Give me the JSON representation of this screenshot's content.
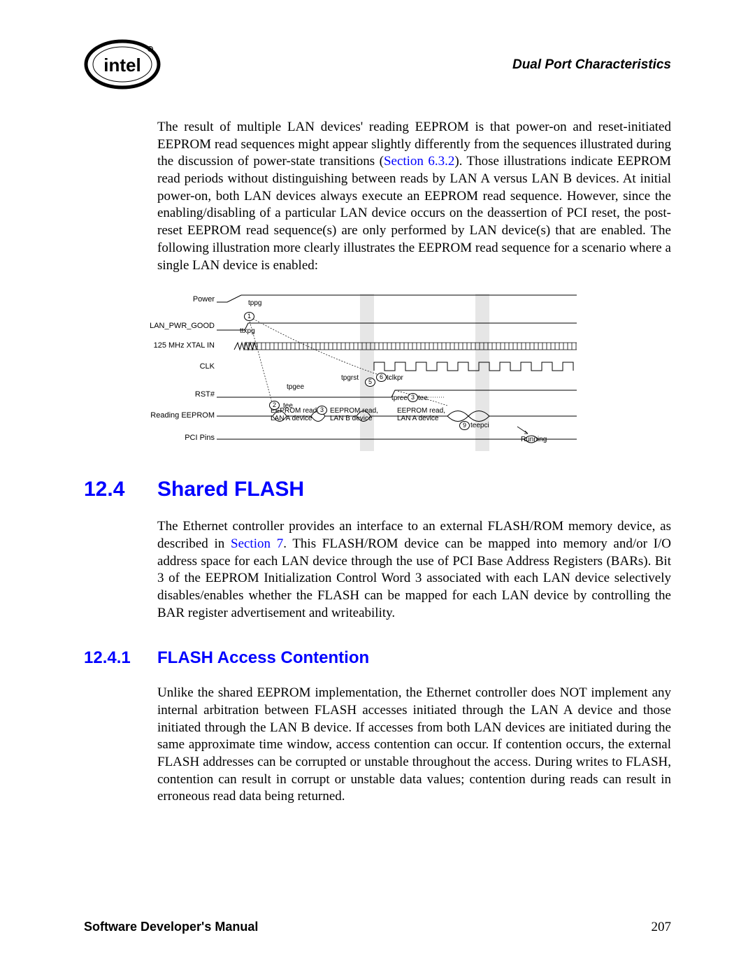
{
  "header": {
    "logo_label": "intel",
    "right": "Dual Port Characteristics"
  },
  "para1_a": "The result of multiple LAN devices' reading EEPROM is that power-on and reset-initiated EEPROM read sequences might appear slightly differently from the sequences illustrated during the discussion of power-state transitions (",
  "para1_link": "Section 6.3.2",
  "para1_b": "). Those illustrations indicate EEPROM read periods without distinguishing between reads by LAN A versus LAN B devices. At initial power-on, both LAN devices always execute an EEPROM read sequence. However, since the enabling/disabling of a particular LAN device occurs on the deassertion of PCI reset, the post-reset EEPROM read sequence(s) are only performed by LAN device(s) that are enabled. The following illustration more clearly illustrates the EEPROM read sequence for a scenario where a single LAN device is enabled:",
  "diagram": {
    "signals": {
      "power": "Power",
      "lan_pwr_good": "LAN_PWR_GOOD",
      "xtal": "125 MHz XTAL IN",
      "clk": "CLK",
      "rst": "RST#",
      "reading": "Reading EEPROM",
      "pci": "PCI Pins"
    },
    "annotations": {
      "tppg": "tppg",
      "ttxpg": "ttxpg",
      "tpgrst": "tpgrst",
      "tclkpr": "tclkpr",
      "tpgee": "tpgee",
      "tee1": "tee",
      "tee2": "tee",
      "tpree": "tpree",
      "teepci": "teepci",
      "running": "Running",
      "eeprom_a": "EEPROM read,",
      "lan_a": "LAN A device",
      "eeprom_b": "EEPROM read,",
      "lan_b": "LAN B device",
      "eeprom_a2": "EEPROM read,",
      "lan_a2": "LAN A device"
    },
    "markers": {
      "m1": "1",
      "m2": "2",
      "m3": "3",
      "m3b": "3",
      "m5": "5",
      "m6": "6",
      "m9": "9"
    }
  },
  "sec12_4": {
    "num": "12.4",
    "title": "Shared FLASH"
  },
  "para2_a": "The Ethernet controller provides an interface to an external FLASH/ROM memory device, as described in ",
  "para2_link": "Section 7",
  "para2_b": ". This FLASH/ROM device can be mapped into memory and/or I/O address space for each LAN device through the use of PCI Base Address Registers (BARs). Bit 3 of the EEPROM Initialization Control Word 3 associated with each LAN device selectively disables/enables whether the FLASH can be mapped for each LAN device by controlling the BAR register advertisement and writeability.",
  "sec12_4_1": {
    "num": "12.4.1",
    "title": "FLASH Access Contention"
  },
  "para3": "Unlike the shared EEPROM implementation, the Ethernet controller does NOT implement any internal arbitration between FLASH accesses initiated through the LAN A device and those initiated through the LAN B device. If accesses from both LAN devices are initiated during the same approximate time window, access contention can occur. If contention occurs, the external FLASH addresses can be corrupted or unstable throughout the access. During writes to FLASH, contention can result in corrupt or unstable data values; contention during reads can result in erroneous read data being returned.",
  "footer": {
    "left": "Software Developer's Manual",
    "right": "207"
  }
}
